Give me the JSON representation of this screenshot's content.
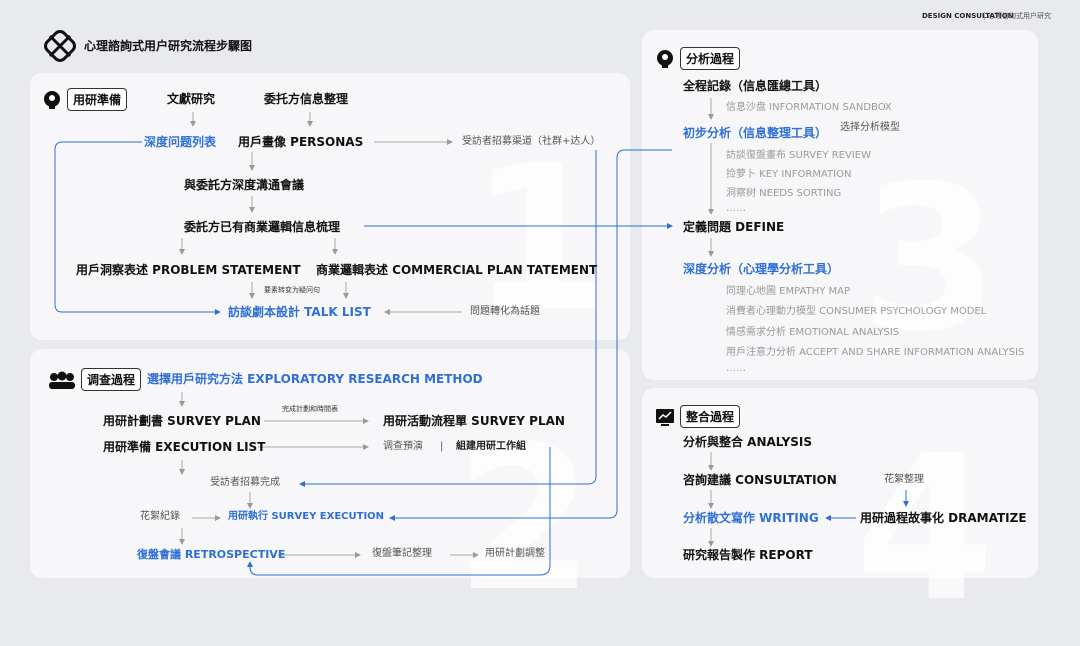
{
  "header": {
    "title": "心理諮詢式用户研究流程步驟图",
    "brand": "DESIGN CONSULTATION",
    "brand_sub": "心理咨询式用户研究"
  },
  "section1": {
    "label": "用研準備",
    "items": {
      "lit": "文獻研究",
      "client_info": "委托方信息整理",
      "question_list": "深度问题列表",
      "personas": "用戶畫像 PERSONAS",
      "recruit": "受訪者招募渠道（社群+达人）",
      "deep_comm": "與委託方深度溝通會議",
      "logic": "委託方已有商業邏輯信息梳理",
      "problem": "用戶洞察表述 PROBLEM STATEMENT",
      "commercial": "商業邏輯表述 COMMERCIAL PLAN TATEMENT",
      "convert_note": "要素转变为疑问句",
      "talk_list": "訪談劇本設計 TALK LIST",
      "topic": "問題轉化為話題"
    }
  },
  "section2": {
    "label": "调查過程",
    "items": {
      "method": "選擇用戶研究方法 EXPLORATORY RESEARCH METHOD",
      "survey_plan": "用研計劃書 SURVEY PLAN",
      "plan_note": "完成計劃和時間表",
      "activity": "用研活動流程單 SURVEY PLAN",
      "exec_list": "用研準備 EXECUTION LIST",
      "pretest": "调查預演",
      "sep": "|",
      "team": "組建用研工作組",
      "recruit_done": "受訪者招募完成",
      "notes": "花絮紀錄",
      "execution": "用研執行 SURVEY EXECUTION",
      "retro": "復盤會議 RETROSPECTIVE",
      "retro_notes": "復盤筆記整理",
      "adjust": "用研計劃調整"
    }
  },
  "section3": {
    "label": "分析過程",
    "items": {
      "record": "全程記錄（信息匯總工具）",
      "sandbox": "信息沙盘 INFORMATION SANDBOX",
      "initial": "初步分析（信息整理工具）",
      "model": "选择分析模型",
      "review": "訪談復盤畫布 SURVEY REVIEW",
      "key": "捡萝卜 KEY INFORMATION",
      "needs": "洞察树 NEEDS SORTING",
      "dots1": "……",
      "define": "定義問題 DEFINE",
      "deep": "深度分析（心理學分析工具）",
      "empathy": "同理心地圖 EMPATHY MAP",
      "psych": "消費者心理動力模型 CONSUMER PSYCHOLOGY MODEL",
      "emotion": "情感需求分析 EMOTIONAL ANALYSIS",
      "attention": "用戶注意力分析 ACCEPT AND SHARE INFORMATION ANALYSIS",
      "dots2": "……"
    }
  },
  "section4": {
    "label": "整合過程",
    "items": {
      "analysis": "分析與整合 ANALYSIS",
      "consult": "咨詢建議 CONSULTATION",
      "tidbits": "花絮整理",
      "writing": "分析散文寫作 WRITING",
      "dramatize": "用研過程故事化 DRAMATIZE",
      "report": "研究報告製作 REPORT"
    }
  },
  "big_numbers": [
    "1",
    "2",
    "3",
    "4"
  ],
  "colors": {
    "accent": "#2f6fd6",
    "panel": "#f7f7f9",
    "bg": "#e9eaee"
  }
}
